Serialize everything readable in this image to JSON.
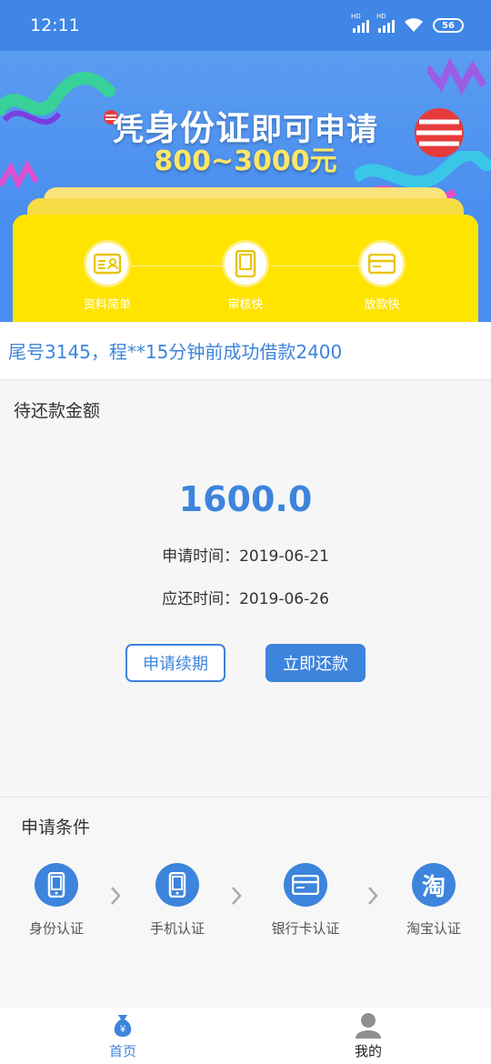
{
  "status_bar": {
    "time": "12:11",
    "signal_badge": "HD",
    "battery": "56"
  },
  "banner": {
    "title_prefix": "凭",
    "title_strong": "身份证",
    "title_suffix": "即可申请",
    "amount_range": "800~3000元",
    "features": [
      {
        "label": "资料简单",
        "icon": "id-card-icon"
      },
      {
        "label": "审核快",
        "icon": "tablet-icon"
      },
      {
        "label": "放款快",
        "icon": "bank-card-icon"
      }
    ],
    "colors": {
      "sky": "#4b8ff0",
      "card": "#ffe400",
      "amount": "#ffe766"
    }
  },
  "ticker": {
    "text": "尾号3145，程**15分钟前成功借款2400"
  },
  "repayment": {
    "title": "待还款金额",
    "amount": "1600.0",
    "apply_date": "申请时间：2019-06-21",
    "due_date": "应还时间：2019-06-26",
    "renew_button": "申请续期",
    "repay_button": "立即还款",
    "accent": "#3d84dc"
  },
  "conditions": {
    "title": "申请条件",
    "items": [
      {
        "label": "身份认证",
        "icon": "phone-icon"
      },
      {
        "label": "手机认证",
        "icon": "phone-icon"
      },
      {
        "label": "银行卡认证",
        "icon": "bank-card-icon"
      },
      {
        "label": "淘宝认证",
        "icon": "taobao-icon",
        "glyph": "淘"
      }
    ]
  },
  "bottom_nav": {
    "home": {
      "label": "首页",
      "icon": "money-bag-icon",
      "symbol": "¥"
    },
    "mine": {
      "label": "我的",
      "icon": "person-icon"
    }
  }
}
